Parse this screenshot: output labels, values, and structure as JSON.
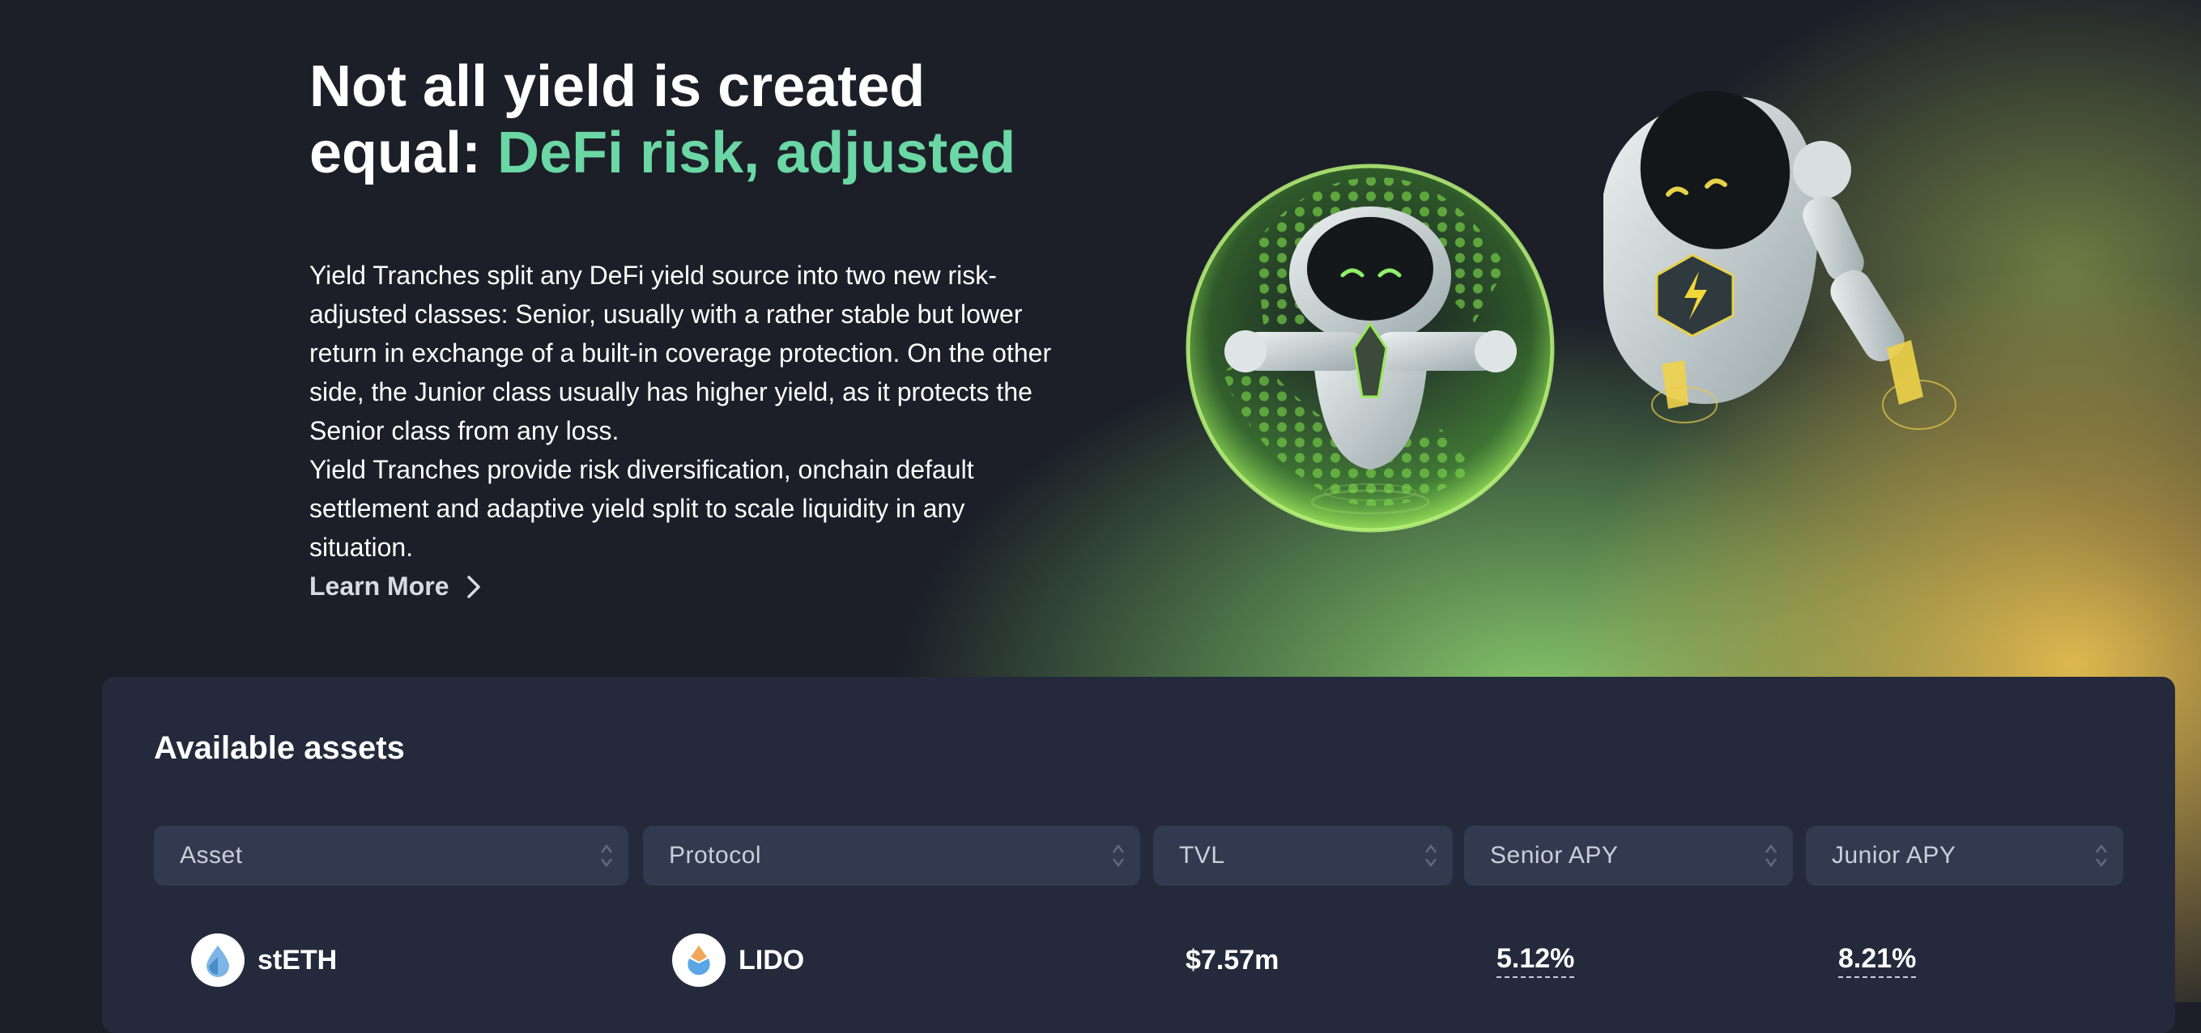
{
  "hero": {
    "title_line1": "Not all yield is created",
    "title_line2_plain": "equal: ",
    "title_line2_accent": "DeFi risk, adjusted",
    "description": "Yield Tranches split any DeFi yield source into two new risk-adjusted classes: Senior, usually with a rather stable but lower return in exchange of a built-in coverage protection. On the other side, the Junior class usually has higher yield, as it protects the Senior class from any loss.",
    "description2": "Yield Tranches provide risk diversification, onchain default settlement and adaptive yield split to scale liquidity in any situation.",
    "learn_more": "Learn More"
  },
  "assets": {
    "title": "Available assets",
    "columns": [
      "Asset",
      "Protocol",
      "TVL",
      "Senior APY",
      "Junior APY"
    ],
    "rows": [
      {
        "asset": "stETH",
        "protocol": "LIDO",
        "tvl": "$7.57m",
        "senior_apy": "5.12%",
        "junior_apy": "8.21%"
      }
    ]
  },
  "colors": {
    "accent": "#6ad7a4",
    "background": "#1c1f28",
    "card": "#242a3b",
    "header_cell": "#323a4f"
  },
  "icons": [
    "chevron-right-icon",
    "sort-icon",
    "steth-logo",
    "lido-logo",
    "robot-shield-illustration",
    "robot-flying-illustration"
  ]
}
